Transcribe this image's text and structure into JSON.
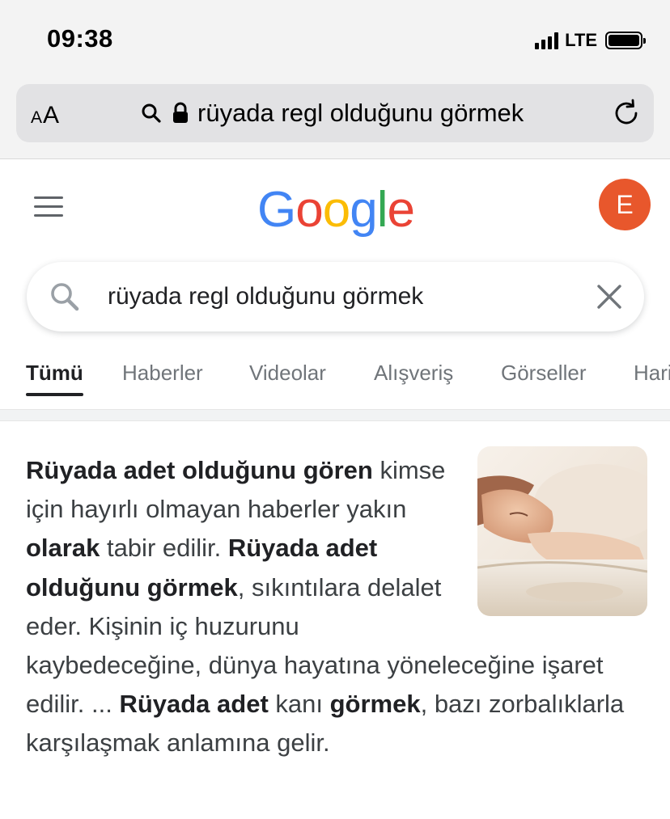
{
  "status_bar": {
    "time": "09:38",
    "network": "LTE"
  },
  "safari": {
    "text_size_small": "A",
    "text_size_large": "A",
    "url_text": "rüyada regl olduğunu görmek"
  },
  "google": {
    "logo": {
      "letters": [
        "G",
        "o",
        "o",
        "g",
        "l",
        "e"
      ],
      "colors": [
        "#4285F4",
        "#EA4335",
        "#FBBC05",
        "#4285F4",
        "#34A853",
        "#EA4335"
      ]
    },
    "avatar_letter": "E",
    "avatar_color": "#E8572C",
    "search": {
      "query": "rüyada regl olduğunu görmek"
    },
    "tabs": [
      "Tümü",
      "Haberler",
      "Videolar",
      "Alışveriş",
      "Görseller",
      "Haritalar"
    ],
    "active_tab": "Tümü"
  },
  "snippet": {
    "parts": [
      {
        "text": "Rüyada adet olduğunu gören",
        "bold": true
      },
      {
        "text": " kimse için hayırlı olmayan haberler yakın ",
        "bold": false
      },
      {
        "text": "olarak",
        "bold": true
      },
      {
        "text": " tabir edilir. ",
        "bold": false
      },
      {
        "text": "Rüyada adet olduğunu görmek",
        "bold": true
      },
      {
        "text": ", sıkıntılara delalet eder. Kişinin iç huzurunu kaybedeceğine, dünya hayatına yöneleceğine işaret edilir. ... ",
        "bold": false
      },
      {
        "text": "Rüyada adet",
        "bold": true
      },
      {
        "text": " kanı ",
        "bold": false
      },
      {
        "text": "görmek",
        "bold": true
      },
      {
        "text": ", bazı zorbalıklarla karşılaşmak anlamına gelir.",
        "bold": false
      }
    ]
  }
}
